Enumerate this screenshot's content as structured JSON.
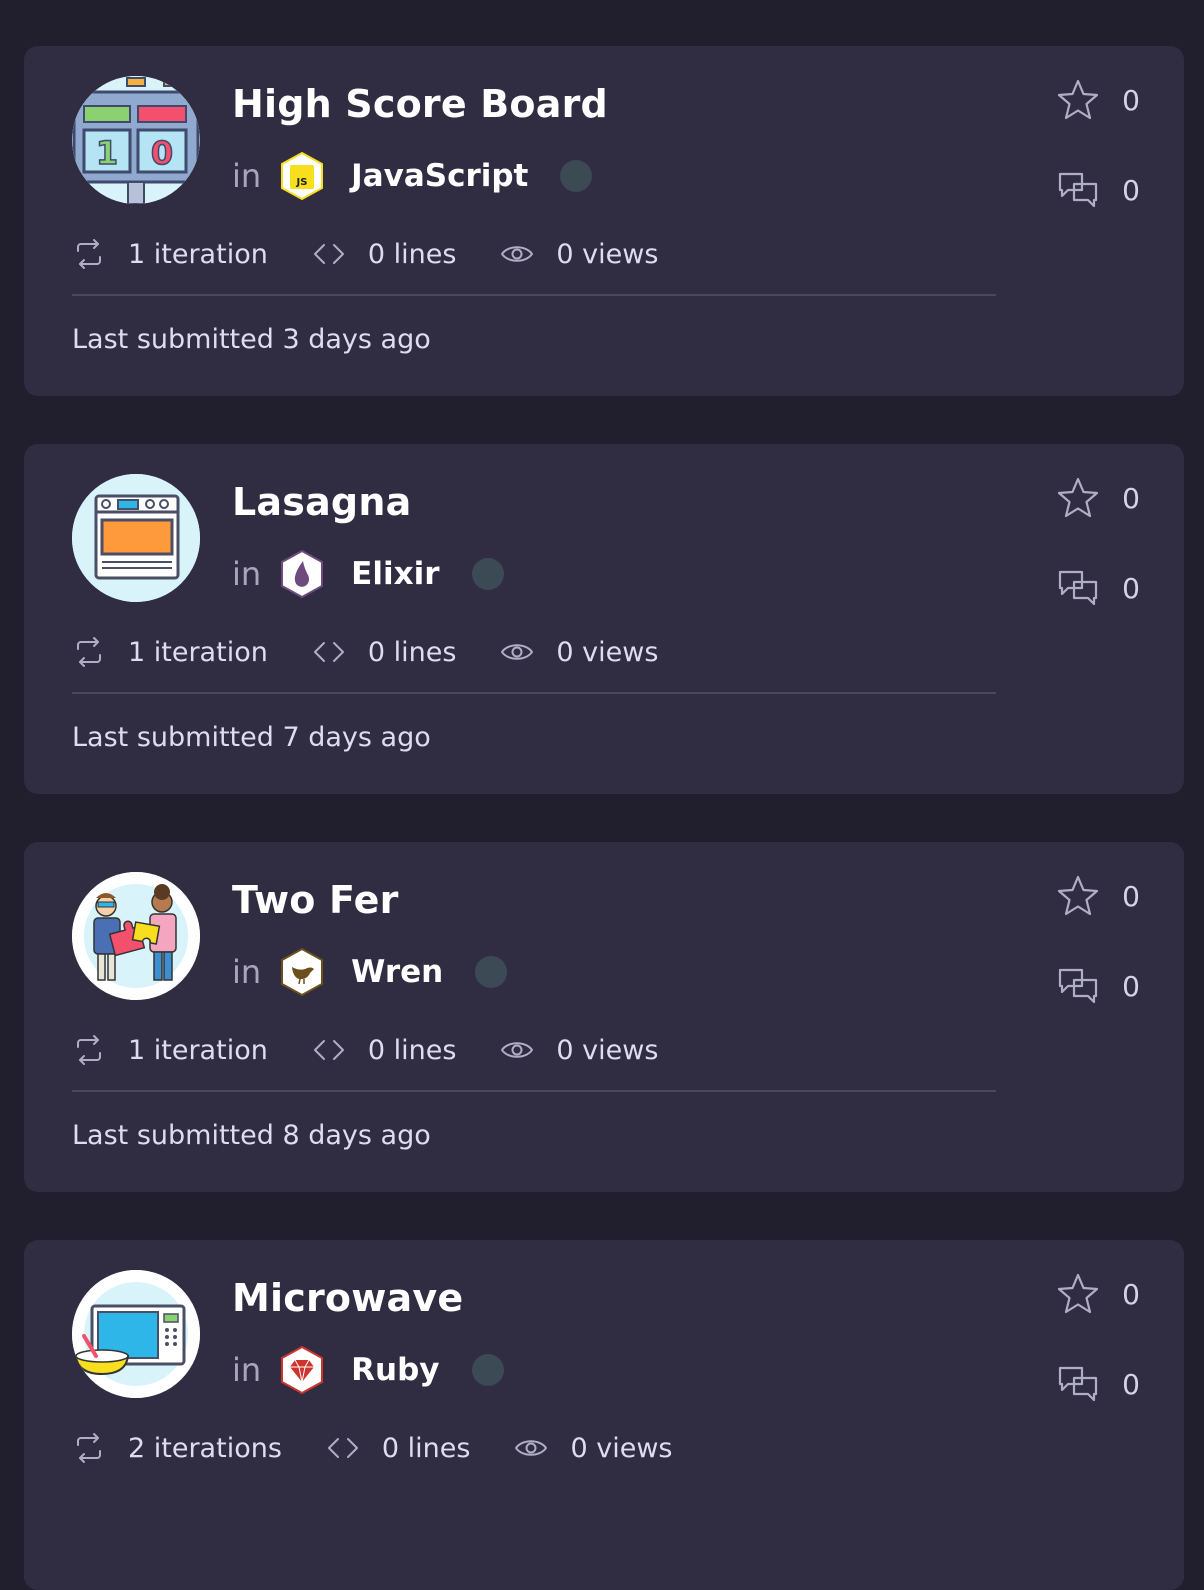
{
  "solutions": [
    {
      "title": "High Score Board",
      "in_label": "in",
      "track": {
        "name": "JavaScript",
        "icon": "javascript-icon",
        "badge_text": "JS",
        "color": "#f7df1e"
      },
      "iterations": "1 iteration",
      "lines": "0 lines",
      "views": "0 views",
      "last_submitted": "Last submitted 3 days ago",
      "stars": "0",
      "comments": "0",
      "avatar": "scoreboard-icon"
    },
    {
      "title": "Lasagna",
      "in_label": "in",
      "track": {
        "name": "Elixir",
        "icon": "elixir-icon",
        "color": "#6e4a7e"
      },
      "iterations": "1 iteration",
      "lines": "0 lines",
      "views": "0 views",
      "last_submitted": "Last submitted 7 days ago",
      "stars": "0",
      "comments": "0",
      "avatar": "oven-icon"
    },
    {
      "title": "Two Fer",
      "in_label": "in",
      "track": {
        "name": "Wren",
        "icon": "wren-icon",
        "color": "#6b4f1d"
      },
      "iterations": "1 iteration",
      "lines": "0 lines",
      "views": "0 views",
      "last_submitted": "Last submitted 8 days ago",
      "stars": "0",
      "comments": "0",
      "avatar": "puzzle-people-icon"
    },
    {
      "title": "Microwave",
      "in_label": "in",
      "track": {
        "name": "Ruby",
        "icon": "ruby-icon",
        "color": "#cc342d"
      },
      "iterations": "2 iterations",
      "lines": "0 lines",
      "views": "0 views",
      "last_submitted": "",
      "stars": "0",
      "comments": "0",
      "avatar": "microwave-icon"
    }
  ],
  "colors": {
    "background": "#211f2e",
    "card": "#302d43",
    "muted_text": "#a8a6bd",
    "status_dot": "#3c4a55"
  }
}
